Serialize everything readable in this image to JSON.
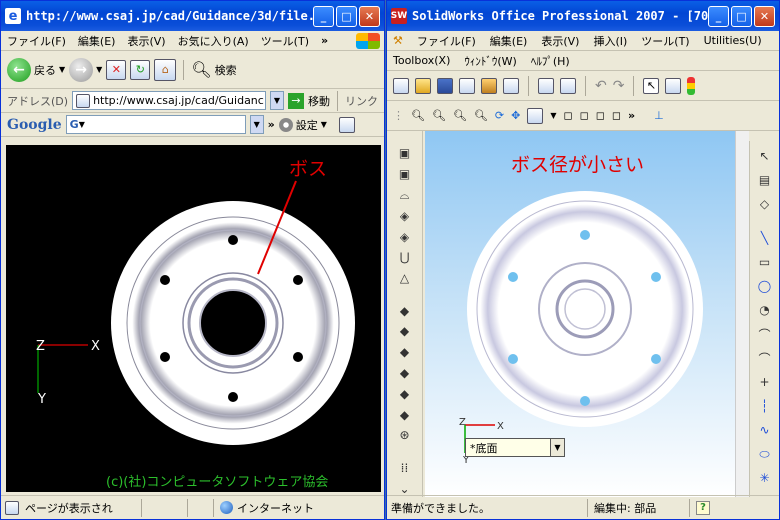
{
  "ie": {
    "title": "http://www.csaj.jp/cad/Guidance/3d/file...",
    "menu": [
      "ファイル(F)",
      "編集(E)",
      "表示(V)",
      "お気に入り(A)",
      "ツール(T)"
    ],
    "toolbar": {
      "back": "戻る",
      "search": "検索"
    },
    "address": {
      "label": "アドレス(D)",
      "url": "http://www.csaj.jp/cad/Guidanc",
      "go": "移動",
      "links": "リンク"
    },
    "google": {
      "logo": "Google",
      "g_field": "G",
      "settings": "設定"
    },
    "viewport": {
      "annotation": "ボス",
      "axis_x": "X",
      "axis_y": "Y",
      "axis_z": "Z",
      "copyright": "(c)(社)コンピュータソフトウェア協会"
    },
    "status": {
      "text": "ページが表示され",
      "zone": "インターネット"
    }
  },
  "sw": {
    "title": "SolidWorks Office Professional 2007 - [70...",
    "menu1": [
      "ファイル(F)",
      "編集(E)",
      "表示(V)",
      "挿入(I)",
      "ツール(T)",
      "Utilities(U)"
    ],
    "menu2": [
      "Toolbox(X)",
      "ｳｨﾝﾄﾞｳ(W)",
      "ﾍﾙﾌﾟ(H)"
    ],
    "viewport": {
      "annotation": "ボス径が小さい",
      "axis_x": "X",
      "axis_y": "Y",
      "axis_z": "Z",
      "view_orientation": "*底面"
    },
    "status": {
      "text": "準備ができました。",
      "mode": "編集中: 部品",
      "help": "?"
    }
  },
  "colors": {
    "annotation_red": "#e00000",
    "sw_hole": "#6fc0ee",
    "ie_bg": "#000000"
  }
}
